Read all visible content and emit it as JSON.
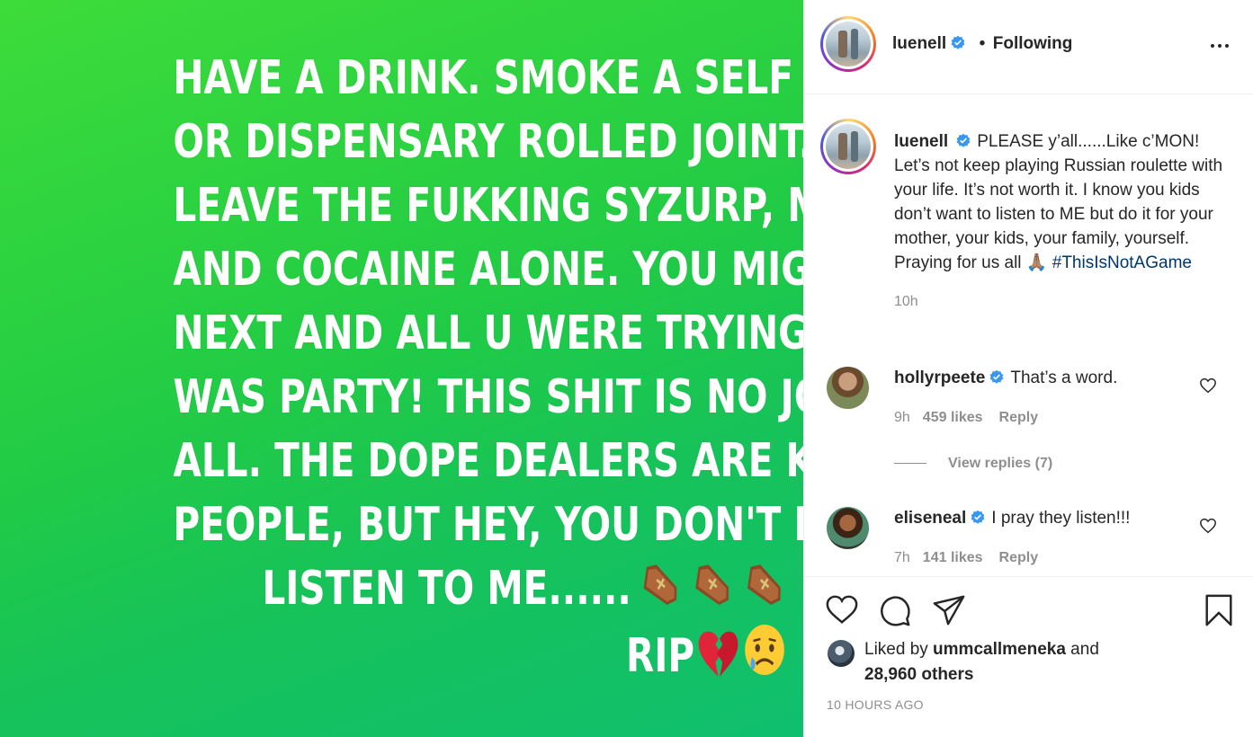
{
  "post": {
    "story_lines": [
      "HAVE A DRINK. SMOKE A SELF ROLLED",
      "OR DISPENSARY  ROLLED JOINT.",
      "LEAVE THE FUKKING SYZURP, MOLLY",
      "AND COCAINE ALONE. YOU MIGHT BE",
      "NEXT AND ALL U WERE  TRYING TO DO",
      "WAS PARTY! THIS SHIT IS NO JOKE AT",
      "ALL. THE DOPE DEALERS ARE KILLING",
      "PEOPLE, BUT HEY, YOU DON'T HAVE TO",
      "LISTEN TO ME......"
    ],
    "rip_text": "RIP",
    "background_colors": [
      "#3ddc3a",
      "#10bf6e"
    ]
  },
  "header": {
    "username": "luenell",
    "separator": "•",
    "follow_status": "Following"
  },
  "caption": {
    "username": "luenell",
    "text": "PLEASE y’all......Like c’MON! Let’s not keep playing Russian roulette with your life. It’s not worth it. I know you kids don’t want to listen to ME but do it for your mother, your kids, your family, yourself. Praying for us all ",
    "emoji": "🙏🏽",
    "hashtag": "#ThisIsNotAGame",
    "time": "10h"
  },
  "comments": [
    {
      "username": "hollyrpeete",
      "text": "That’s a word.",
      "time": "9h",
      "likes": "459 likes",
      "reply_label": "Reply",
      "view_replies": "View replies (7)"
    },
    {
      "username": "eliseneal",
      "text": "I pray they listen!!!",
      "time": "7h",
      "likes": "141 likes",
      "reply_label": "Reply"
    }
  ],
  "likes": {
    "prefix": "Liked by ",
    "user": "ummcallmeneka",
    "middle": " and",
    "others": "28,960 others"
  },
  "post_time": "10 HOURS AGO",
  "colors": {
    "verified": "#3897f0",
    "text": "#262626",
    "secondary": "#8e8e8e",
    "hashtag": "#00376b",
    "border": "#efefef"
  }
}
